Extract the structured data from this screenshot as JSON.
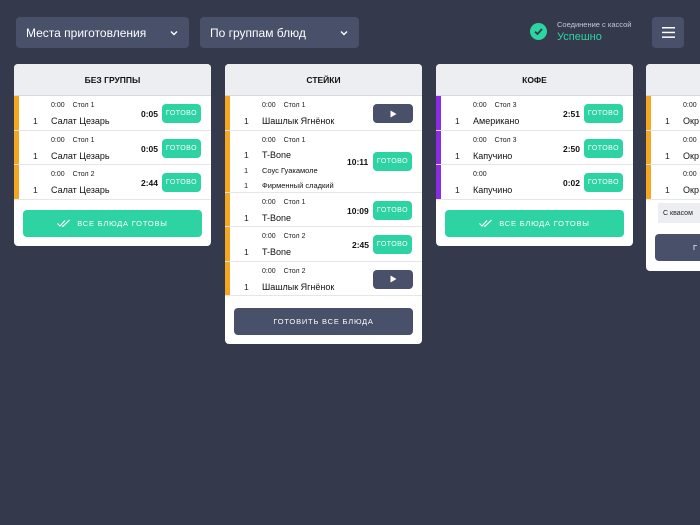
{
  "header": {
    "place_select": "Места приготовления",
    "group_select": "По группам блюд",
    "connection_label": "Соединение с кассой",
    "connection_status": "Успешно"
  },
  "colors": {
    "accent_green": "#2ed3a3",
    "orange_bar": "#f5a623",
    "purple_bar": "#8a2be2",
    "dark_button": "#48506a"
  },
  "cards": [
    {
      "title": "БЕЗ ГРУППЫ",
      "footer": "ВСЕ БЛЮДА ГОТОВЫ",
      "rows": [
        {
          "time_stamp": "0:00",
          "table": "Стол 1",
          "qty": "1",
          "name": "Салат Цезарь",
          "timer": "0:05",
          "action": "ГОТОВО"
        },
        {
          "time_stamp": "0:00",
          "table": "Стол 1",
          "qty": "1",
          "name": "Салат Цезарь",
          "timer": "0:05",
          "action": "ГОТОВО"
        },
        {
          "time_stamp": "0:00",
          "table": "Стол 2",
          "qty": "1",
          "name": "Салат Цезарь",
          "timer": "2:44",
          "action": "ГОТОВО"
        }
      ]
    },
    {
      "title": "СТЕЙКИ",
      "footer": "ГОТОВИТЬ ВСЕ БЛЮДА",
      "rows": [
        {
          "time_stamp": "0:00",
          "table": "Стол 1",
          "qty": "1",
          "name": "Шашлык Ягнёнок"
        },
        {
          "time_stamp": "0:00",
          "table": "Стол 1",
          "qty": "1",
          "name": "T-Bone",
          "timer": "10:11",
          "action": "ГОТОВО",
          "mod1_qty": "1",
          "mod1": "Соус Гуакамоле",
          "mod2_qty": "1",
          "mod2": "Фирменный сладкий"
        },
        {
          "time_stamp": "0:00",
          "table": "Стол 1",
          "qty": "1",
          "name": "T-Bone",
          "timer": "10:09",
          "action": "ГОТОВО"
        },
        {
          "time_stamp": "0:00",
          "table": "Стол 2",
          "qty": "1",
          "name": "T-Bone",
          "timer": "2:45",
          "action": "ГОТОВО"
        },
        {
          "time_stamp": "0:00",
          "table": "Стол 2",
          "qty": "1",
          "name": "Шашлык Ягнёнок"
        }
      ]
    },
    {
      "title": "КОФЕ",
      "footer": "ВСЕ БЛЮДА ГОТОВЫ",
      "rows": [
        {
          "time_stamp": "0:00",
          "table": "Стол 3",
          "qty": "1",
          "name": "Американо",
          "timer": "2:51",
          "action": "ГОТОВО"
        },
        {
          "time_stamp": "0:00",
          "table": "Стол 3",
          "qty": "1",
          "name": "Капучино",
          "timer": "2:50",
          "action": "ГОТОВО"
        },
        {
          "time_stamp": "0:00",
          "table": "",
          "qty": "1",
          "name": "Капучино",
          "timer": "0:02",
          "action": "ГОТОВО"
        }
      ]
    },
    {
      "title": "",
      "footer": "Г",
      "comment": "С квасом",
      "rows": [
        {
          "time_stamp": "0:00",
          "qty": "1",
          "name": "Окр"
        },
        {
          "time_stamp": "0:00",
          "qty": "1",
          "name": "Окр"
        },
        {
          "time_stamp": "0:00",
          "qty": "1",
          "name": "Окр"
        }
      ]
    }
  ]
}
